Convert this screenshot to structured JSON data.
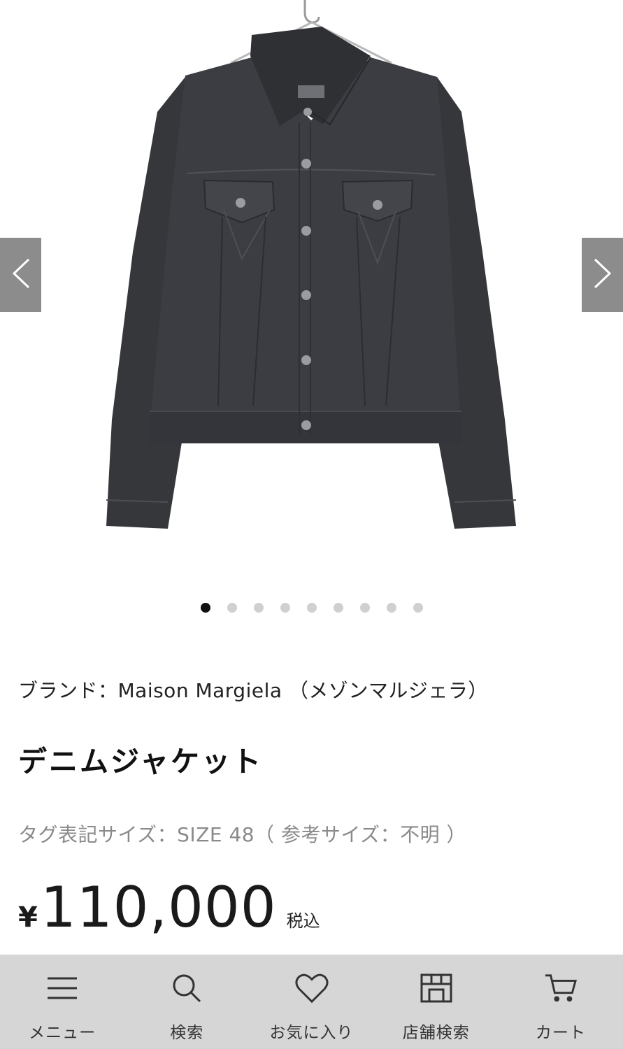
{
  "gallery": {
    "image_alt": "デニムジャケット",
    "slide_count": 9,
    "active_slide": 1,
    "dots": [
      "",
      "",
      "",
      "",
      "",
      "",
      "",
      "",
      ""
    ],
    "prev_icon": "chevron-left-icon",
    "next_icon": "chevron-right-icon"
  },
  "product": {
    "brand": "ブランド：Maison Margiela （メゾンマルジェラ）",
    "title": "デニムジャケット",
    "size": "タグ表記サイズ：SIZE 48（ 参考サイズ：不明 ）",
    "price_symbol": "¥",
    "price": "110,000",
    "tax_label": "税込"
  },
  "bottom_nav": {
    "items": [
      {
        "label": "メニュー",
        "icon": "menu-icon"
      },
      {
        "label": "検索",
        "icon": "search-icon"
      },
      {
        "label": "お気に入り",
        "icon": "heart-icon"
      },
      {
        "label": "店舗検索",
        "icon": "store-icon"
      },
      {
        "label": "カート",
        "icon": "cart-icon"
      }
    ]
  },
  "colors": {
    "arrow_bg": "#8c8c8c",
    "nav_bg": "#d6d6d6",
    "active_dot": "#111111",
    "inactive_dot": "#d0d0d0",
    "jacket": "#3a3b3f"
  }
}
